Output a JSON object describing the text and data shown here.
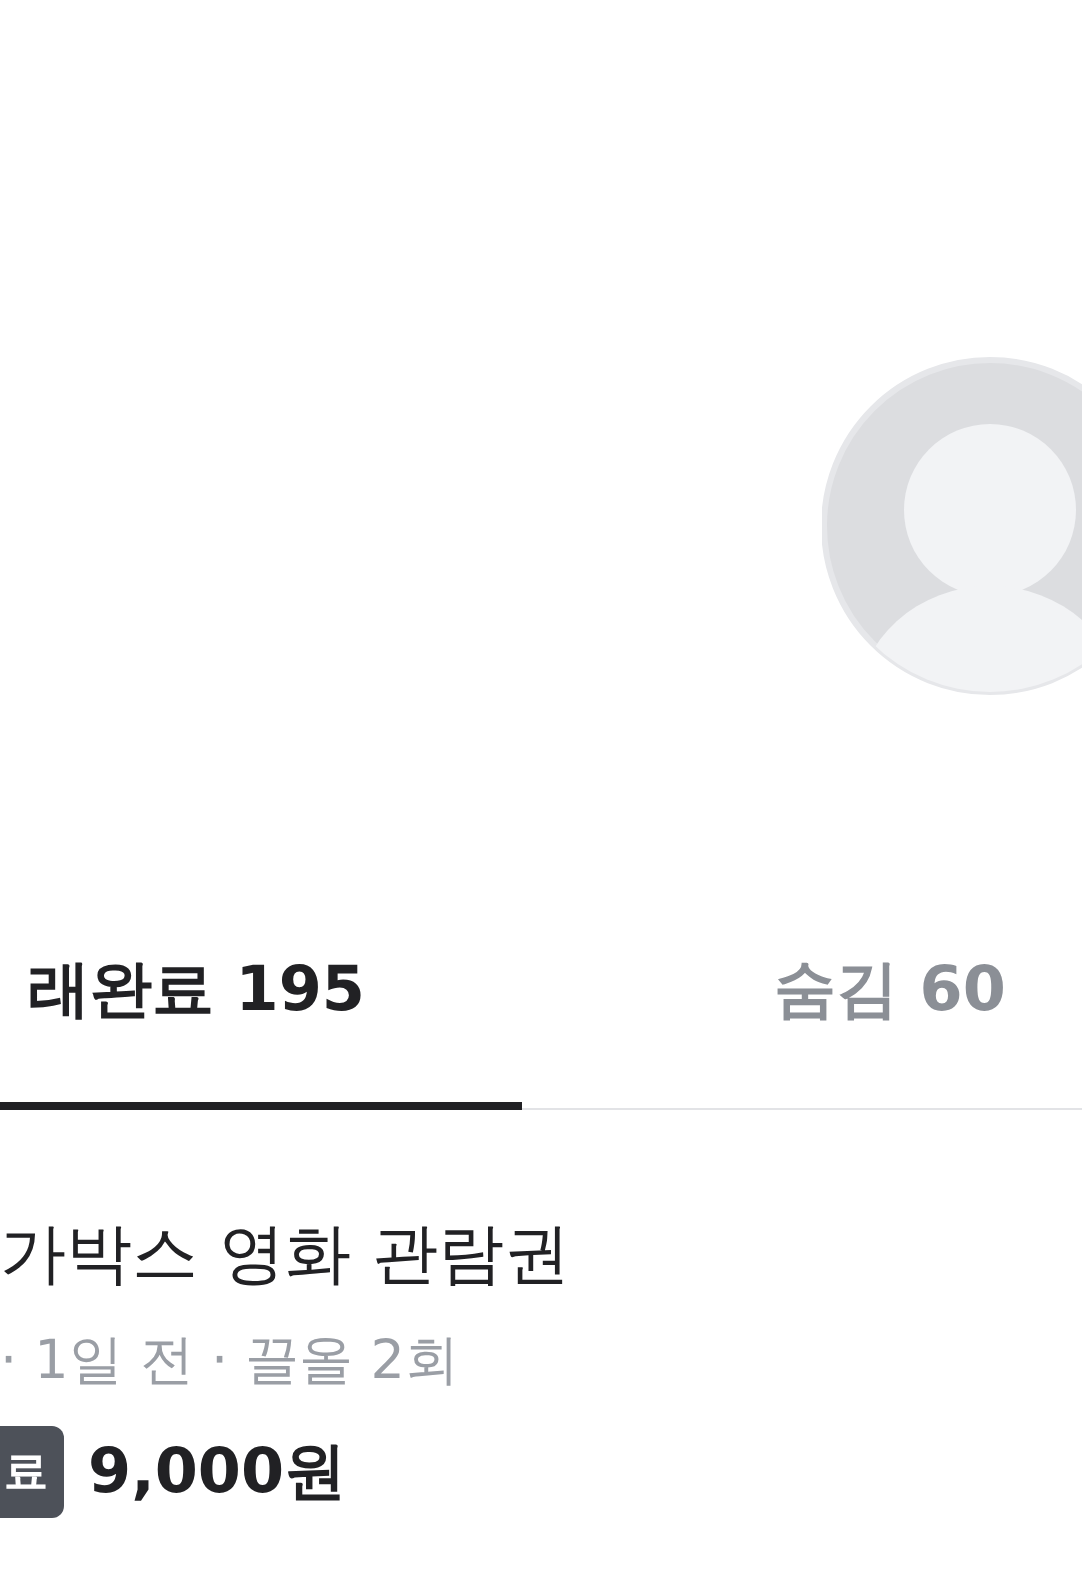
{
  "profile": {
    "avatar": {
      "kind": "placeholder"
    }
  },
  "tabs": [
    {
      "label": "래완료 195",
      "selected": true
    },
    {
      "label": "숨김 60",
      "selected": false
    }
  ],
  "items": [
    {
      "title": "가박스 영화 관람권",
      "meta": "· 1일 전 · 끌올 2회",
      "status": "료",
      "price": "9,000원"
    }
  ]
}
